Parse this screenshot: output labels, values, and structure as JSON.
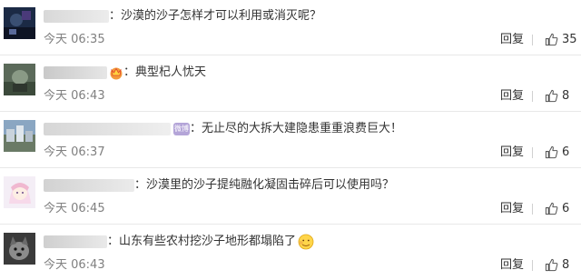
{
  "reply_label": "回复",
  "comments": [
    {
      "name": "██████",
      "text": "：沙漠的沙子怎样才可以利用或消灭呢？",
      "time": "今天 06:35",
      "likes": "35"
    },
    {
      "name": "██████",
      "text": "：典型杞人忧天",
      "time": "今天 06:43",
      "likes": "8"
    },
    {
      "name": "██████",
      "badge": "微博",
      "text": "：无止尽的大拆大建隐患重重浪费巨大！",
      "time": "今天 06:37",
      "likes": "6"
    },
    {
      "name": "██████",
      "text": "：沙漠里的沙子提纯融化凝固击碎后可以使用吗？",
      "time": "今天 06:45",
      "likes": "6"
    },
    {
      "name": "██████",
      "text": "：山东有些农村挖沙子地形都塌陷了",
      "time": "今天 06:43",
      "likes": "8"
    }
  ]
}
